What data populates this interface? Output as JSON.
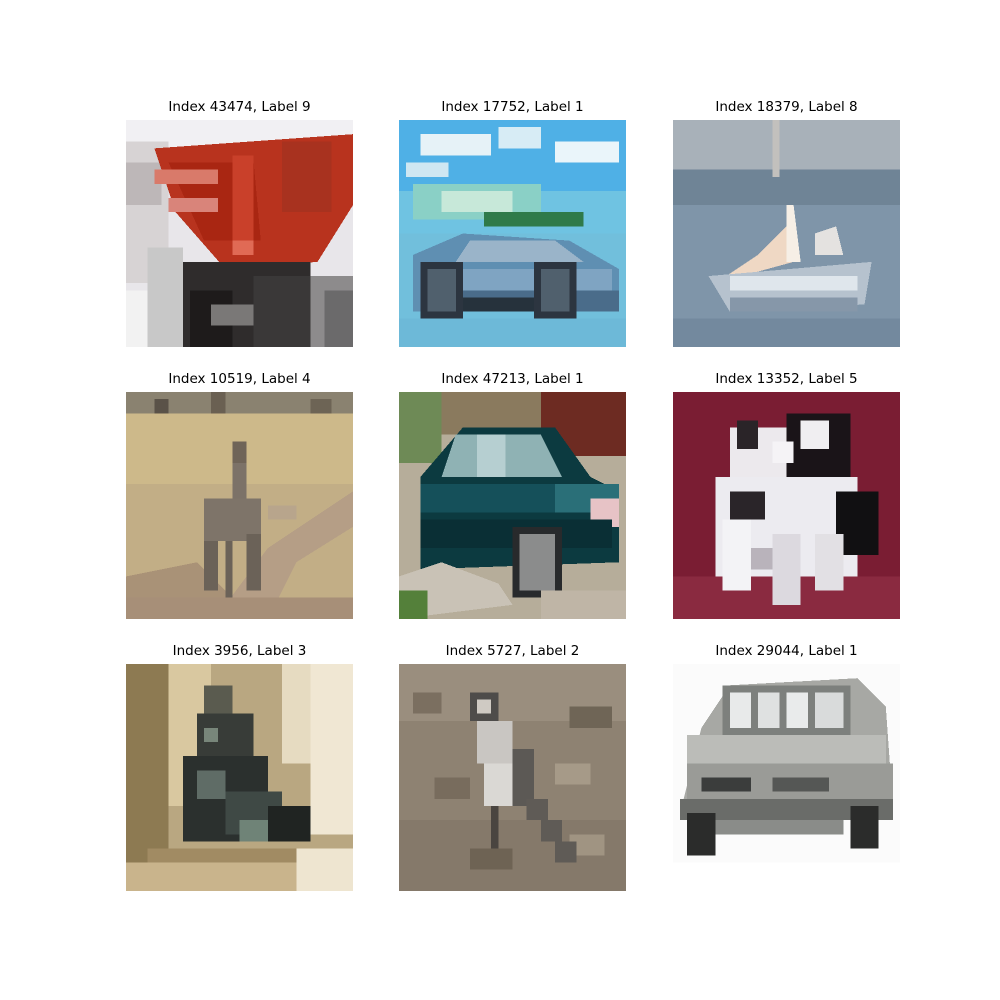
{
  "panels": [
    {
      "title": "Index 43474, Label 9",
      "subject": "red truck"
    },
    {
      "title": "Index 17752, Label 1",
      "subject": "blue car"
    },
    {
      "title": "Index 18379, Label 8",
      "subject": "sailing ship"
    },
    {
      "title": "Index 10519, Label 4",
      "subject": "deer"
    },
    {
      "title": "Index 47213, Label 1",
      "subject": "dark green car"
    },
    {
      "title": "Index 13352, Label 5",
      "subject": "white dog"
    },
    {
      "title": "Index 3956, Label 3",
      "subject": "cat"
    },
    {
      "title": "Index 5727, Label 2",
      "subject": "bird"
    },
    {
      "title": "Index 29044, Label 1",
      "subject": "silver minivan"
    }
  ]
}
